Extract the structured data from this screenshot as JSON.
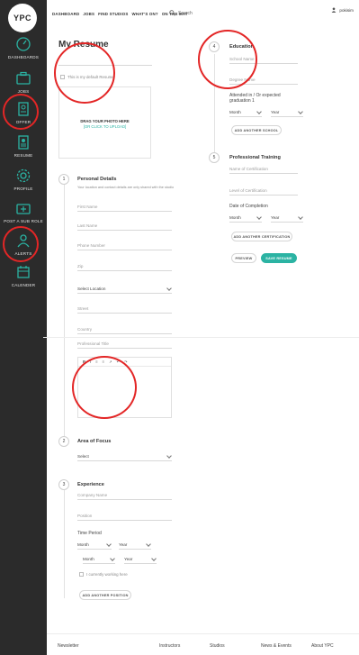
{
  "logo": {
    "text": "YPC"
  },
  "sidebar": {
    "items": [
      {
        "label": "DASHBOARDS",
        "icon": "dashboard-icon"
      },
      {
        "label": "JOBS",
        "icon": "briefcase-icon"
      },
      {
        "label": "OFFER",
        "icon": "document-icon"
      },
      {
        "label": "RESUME",
        "icon": "resume-icon"
      },
      {
        "label": "PROFILE",
        "icon": "gear-icon"
      },
      {
        "label": "POST A SUB ROLE",
        "icon": "post-role-icon"
      },
      {
        "label": "ALERTS",
        "icon": "user-alert-icon"
      },
      {
        "label": "CALENDER",
        "icon": "calendar-icon"
      }
    ]
  },
  "topnav": {
    "items": [
      "DASHBOARD",
      "JOBS",
      "FIND STUDIOS",
      "WHAT'S ON?",
      "ON THE MAT"
    ],
    "search_label": "Search",
    "user_name": "pokisim"
  },
  "page": {
    "title": "My Resume"
  },
  "resume": {
    "default_label": "This is my default Resume",
    "photo_upload": "DRAG YOUR PHOTO HERE",
    "photo_click": "[OR CLICK TO UPLOAD]"
  },
  "personal": {
    "num": "1",
    "title": "Personal Details",
    "note": "Your location and contact details are only shared with the studio",
    "first_name": "First Name",
    "last_name": "Last Name",
    "phone": "Phone Number",
    "zip": "Zip",
    "location": "Select Location",
    "street": "Street",
    "country": "Country",
    "prof_title": "Professional Title",
    "editor_tools": [
      "B",
      "I",
      "≡",
      "≡",
      "↗",
      "↶",
      "↷"
    ]
  },
  "focus": {
    "num": "2",
    "title": "Area of Focus",
    "select": "Select"
  },
  "experience": {
    "num": "3",
    "title": "Experience",
    "company": "Company Name",
    "position": "Position",
    "time_period": "Time Period",
    "month": "Month",
    "year": "Year",
    "currently": "I currently working here",
    "add_btn": "ADD ANOTHER POSITION"
  },
  "education": {
    "num": "4",
    "title": "Education",
    "school": "School Name",
    "degree": "Degree Name",
    "attended": "Attended in / Or expected graduation 1",
    "month": "Month",
    "year": "Year",
    "add_btn": "ADD ANOTHER SCHOOL"
  },
  "training": {
    "num": "5",
    "title": "Professional Training",
    "cert_name": "Name of Certification",
    "cert_level": "Level of Certification",
    "date_label": "Date of Completion",
    "month": "Month",
    "year": "Year",
    "add_btn": "ADD ANOTHER CERTIFICATION"
  },
  "actions": {
    "preview": "PREVIEW",
    "save": "SAVE RESUME"
  },
  "footer": {
    "items": [
      "Newsletter",
      "Instructors",
      "Studios",
      "News & Events",
      "About YPC"
    ]
  },
  "colors": {
    "accent": "#2bb3a3",
    "sidebar": "#2b2b2b",
    "annotation": "#e32626"
  }
}
